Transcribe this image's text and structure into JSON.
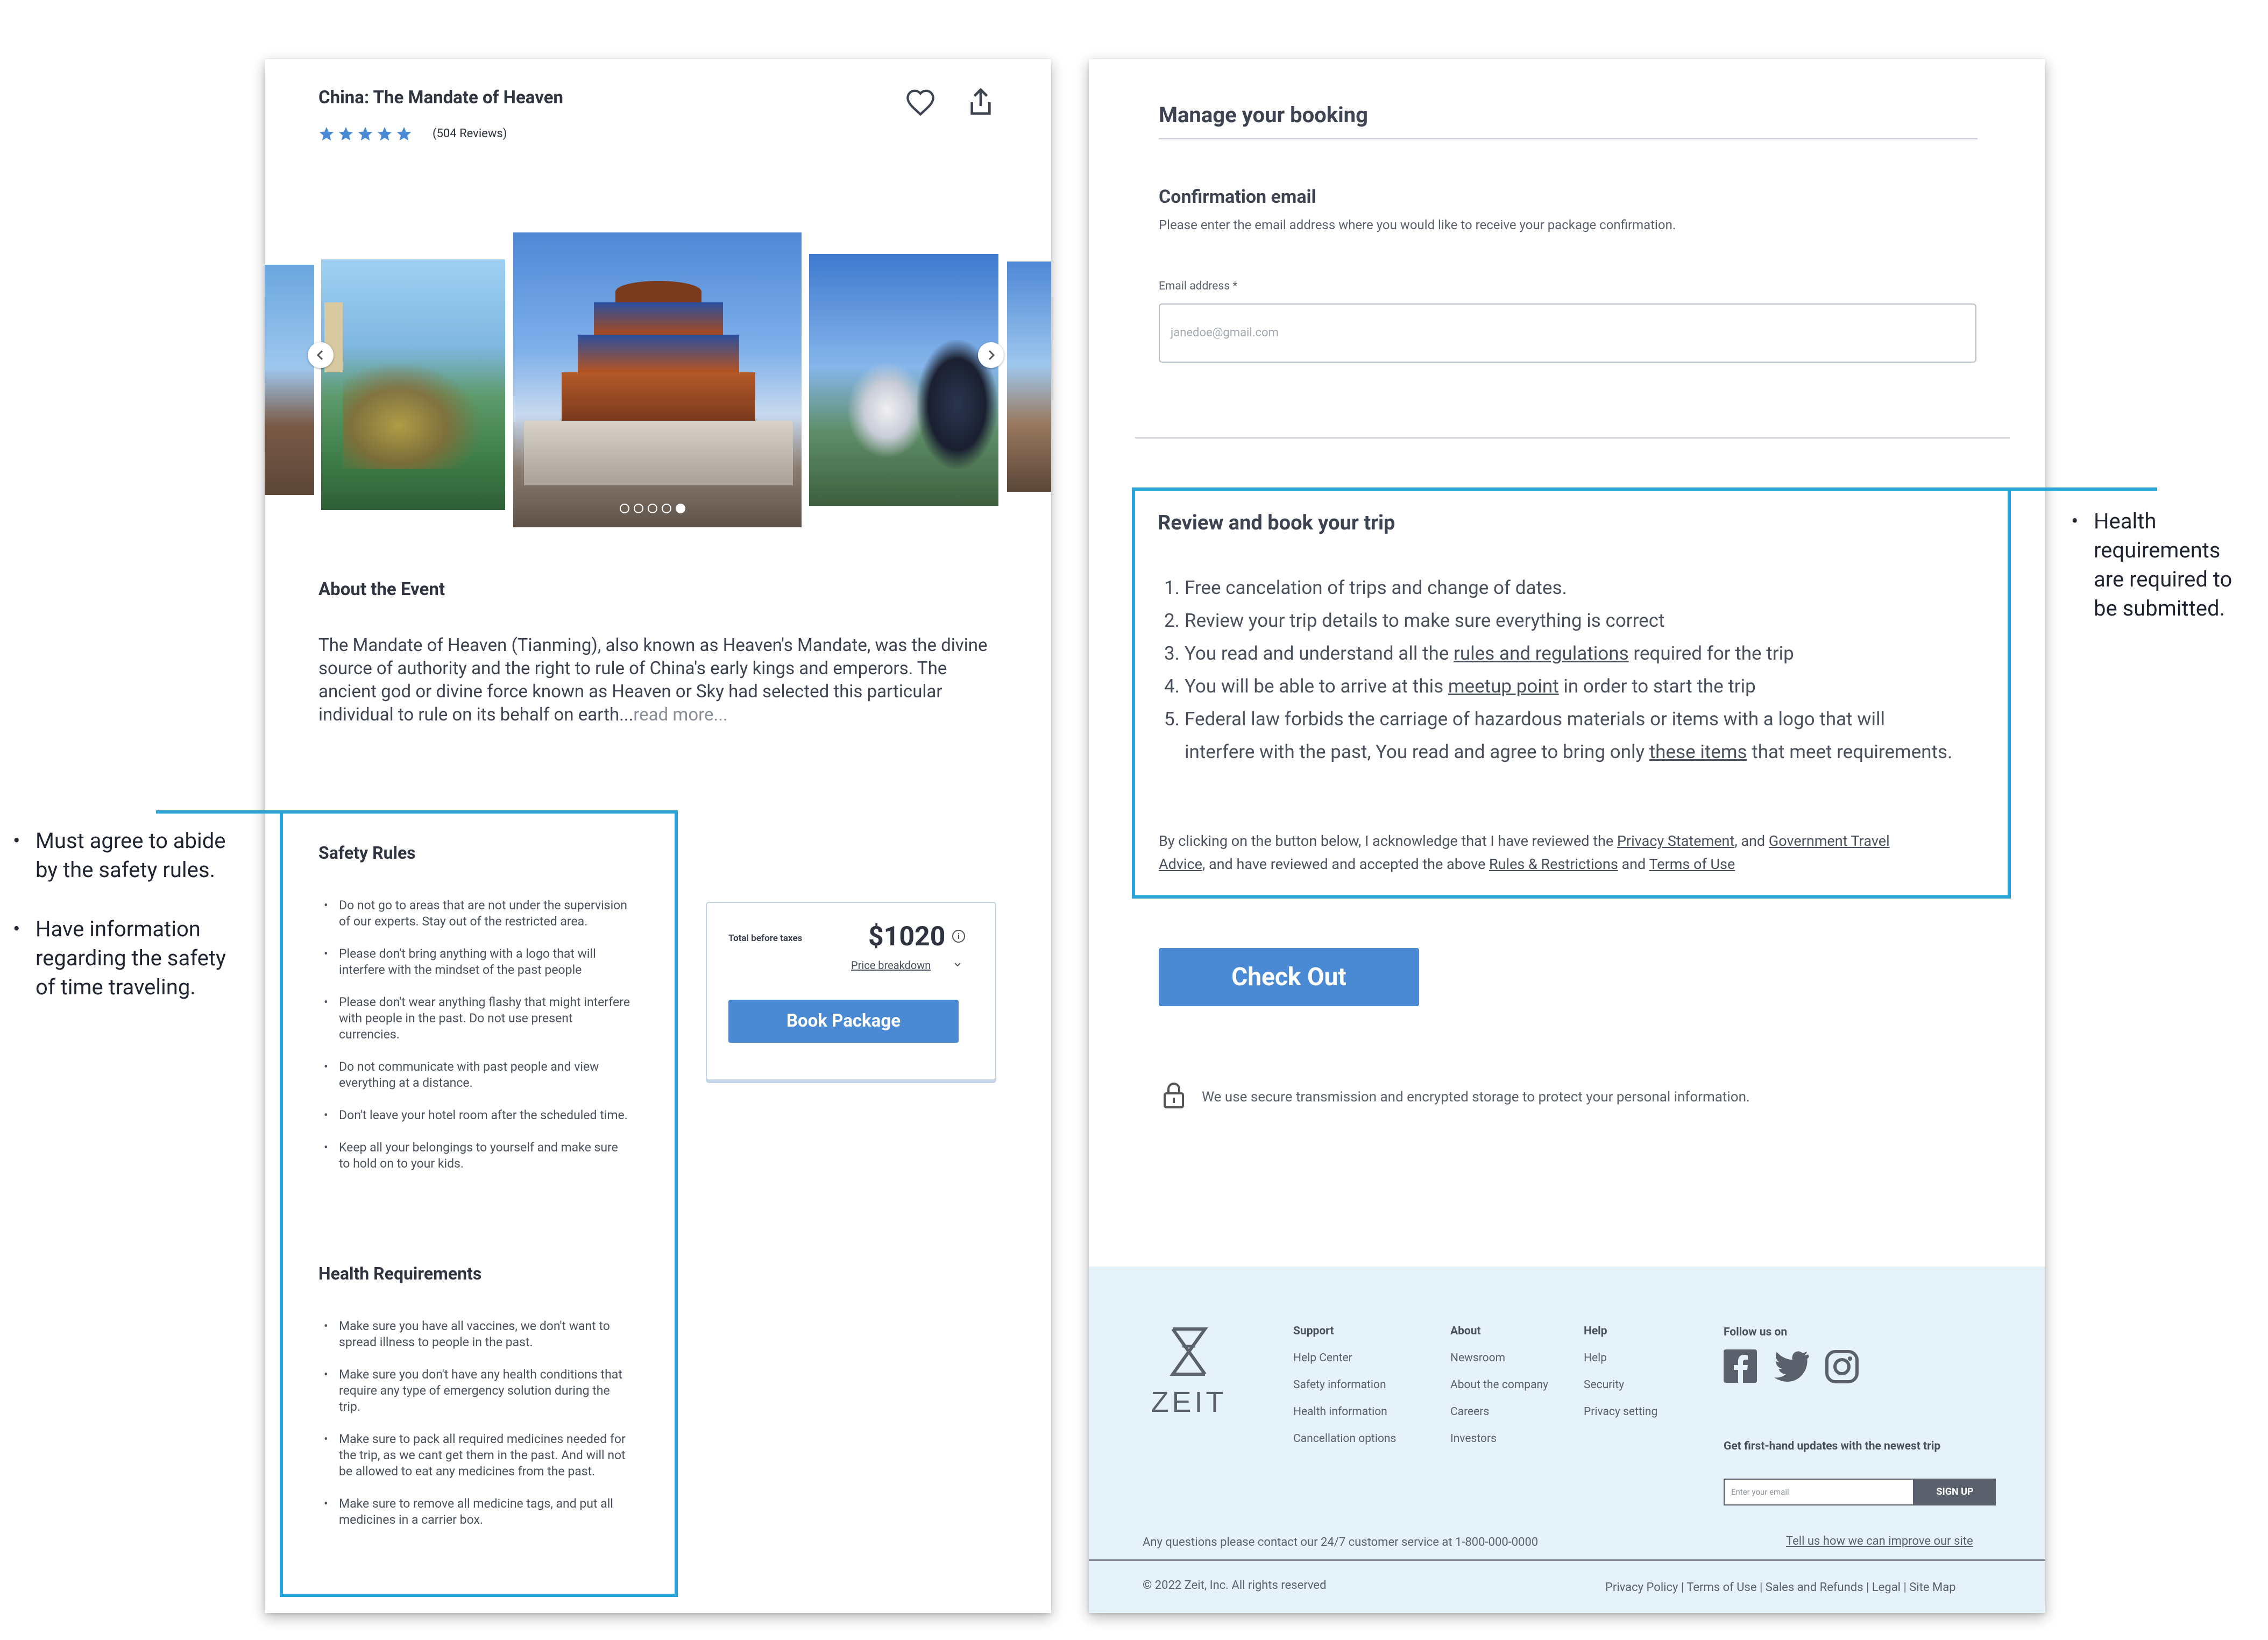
{
  "event": {
    "title": "China: The Mandate of Heaven",
    "reviews": "(504 Reviews)",
    "rating": 5,
    "rating_max": 5,
    "about_heading": "About the Event",
    "about_text": "The Mandate of Heaven (Tianming), also known as Heaven's Mandate, was the divine source of authority and the right to rule of China's early kings and emperors. The ancient god or divine force known as Heaven or Sky had selected this particular individual to rule on its behalf on earth...",
    "read_more": "read more...",
    "carousel_count": 5,
    "carousel_active": 5
  },
  "safety": {
    "heading": "Safety Rules",
    "items": [
      "Do not go to areas that are not under the supervision of our experts. Stay out of the restricted area.",
      "Please don't bring anything with a logo that will interfere with the mindset of the past people",
      "Please don't wear anything flashy that might interfere with people in the past. Do not use present currencies.",
      "Do not communicate with past people and view everything at a distance.",
      "Don't leave your hotel room after the scheduled time.",
      "Keep all your belongings to yourself and make sure to hold on to your kids."
    ]
  },
  "health": {
    "heading": "Health Requirements",
    "items": [
      "Make sure you have all vaccines, we don't want to spread illness to people in the past.",
      "Make sure you don't have any health conditions that require any type of emergency solution during the trip.",
      "Make sure to pack all required medicines needed for the trip, as we cant get them in the past. And will not be allowed to eat any medicines from the past.",
      "Make sure to remove all medicine tags, and put all medicines in a carrier box."
    ]
  },
  "price": {
    "label": "Total before taxes",
    "amount": "$1020",
    "breakdown": "Price breakdown",
    "book_button": "Book Package"
  },
  "booking": {
    "manage_heading": "Manage your booking",
    "confirmation_heading": "Confirmation email",
    "confirmation_desc": "Please enter the email address where you would like to receive your package confirmation.",
    "email_label": "Email address *",
    "email_placeholder": "janedoe@gmail.com",
    "review_heading": "Review and book your trip",
    "review_items": [
      {
        "num": "1.",
        "lines": [
          [
            {
              "t": "Free cancelation of trips and change of dates."
            }
          ]
        ]
      },
      {
        "num": "2.",
        "lines": [
          [
            {
              "t": "Review your trip details to make sure everything is correct"
            }
          ]
        ]
      },
      {
        "num": "3.",
        "lines": [
          [
            {
              "t": "You read and understand all the "
            },
            {
              "t": "rules and regulations",
              "u": true
            },
            {
              "t": " required for the trip"
            }
          ]
        ]
      },
      {
        "num": "4.",
        "lines": [
          [
            {
              "t": "You will be able to arrive at this "
            },
            {
              "t": "meetup point",
              "u": true
            },
            {
              "t": " in order to start the trip"
            }
          ]
        ]
      },
      {
        "num": "5.",
        "lines": [
          [
            {
              "t": "Federal law forbids the carriage of hazardous materials or items with a logo that will"
            }
          ],
          [
            {
              "t": "interfere with the past, You read and agree to bring only "
            },
            {
              "t": "these items",
              "u": true
            },
            {
              "t": " that meet requirements."
            }
          ]
        ]
      }
    ],
    "ack_lines": [
      [
        {
          "t": "By clicking on the button below, I acknowledge that I have reviewed the "
        },
        {
          "t": "Privacy Statement",
          "u": true
        },
        {
          "t": ", and "
        },
        {
          "t": "Government Travel",
          "u": true
        }
      ],
      [
        {
          "t": "Advice",
          "u": true
        },
        {
          "t": ", and have reviewed and accepted the above "
        },
        {
          "t": "Rules & Restrictions",
          "u": true
        },
        {
          "t": " and "
        },
        {
          "t": "Terms of Use",
          "u": true
        }
      ]
    ],
    "checkout_button": "Check Out",
    "secure_note": "We use secure transmission and encrypted storage to protect your personal information."
  },
  "footer": {
    "brand": "ZEIT",
    "columns": [
      {
        "heading": "Support",
        "items": [
          "Help Center",
          "Safety information",
          "Health information",
          "Cancellation options"
        ]
      },
      {
        "heading": "About",
        "items": [
          "Newsroom",
          "About the company",
          "Careers",
          "Investors"
        ]
      },
      {
        "heading": "Help",
        "items": [
          "Help",
          "Security",
          "Privacy setting"
        ]
      }
    ],
    "follow": "Follow us on",
    "social_icons": [
      "facebook-icon",
      "twitter-icon",
      "instagram-icon"
    ],
    "updates": "Get first-hand updates with the newest trip",
    "email_placeholder": "Enter your email",
    "signup": "SIGN UP",
    "questions": "Any questions please contact our 24/7 customer service at 1-800-000-0000",
    "improve": "Tell us how we can improve our site",
    "copyright": "© 2022 Zeit, Inc. All rights reserved",
    "legal_links": "Privacy Policy | Terms of Use | Sales and Refunds | Legal | Site Map"
  },
  "annotations": {
    "left_1": [
      "Must agree to abide",
      "by the safety rules."
    ],
    "left_2": [
      "Have information",
      "regarding the safety",
      "of time traveling."
    ],
    "right": [
      "Health",
      "requirements",
      "are required to",
      "be submitted."
    ]
  },
  "colors": {
    "accent_blue": "#4a8ad4",
    "highlight_outline": "#29a3d6",
    "footer_bg": "#e6f2fa",
    "star": "#4a8ad4"
  }
}
